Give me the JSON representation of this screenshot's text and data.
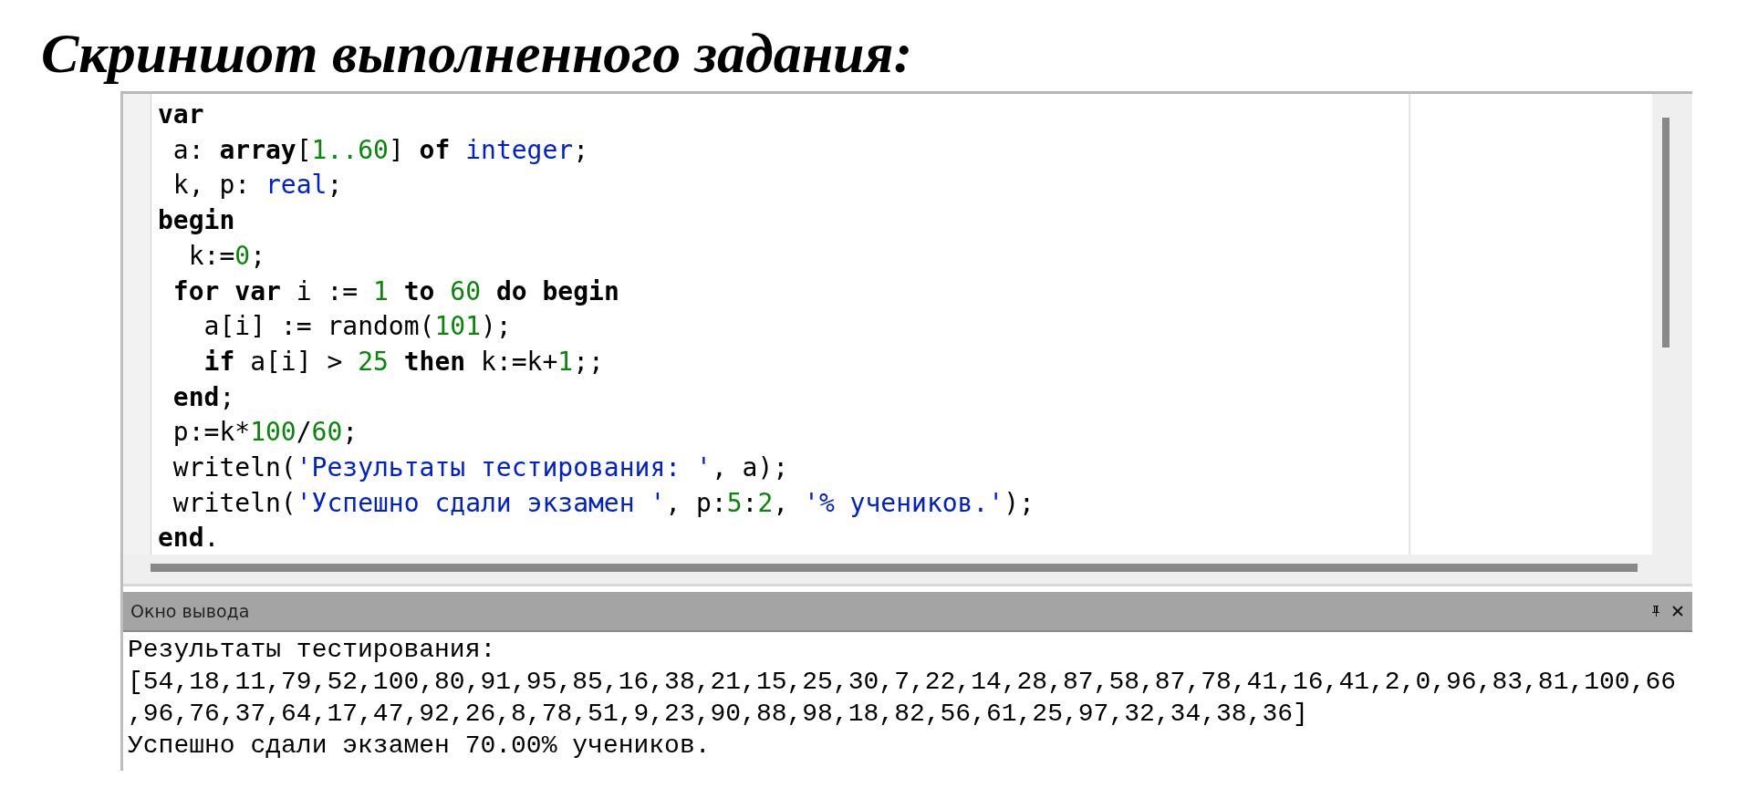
{
  "heading": "Скриншот выполненного задания:",
  "editor": {
    "lines": [
      [
        {
          "text": "var",
          "kind": "keyword"
        }
      ],
      [
        {
          "text": " a: ",
          "kind": "plain"
        },
        {
          "text": "array",
          "kind": "keyword"
        },
        {
          "text": "[",
          "kind": "plain"
        },
        {
          "text": "1..60",
          "kind": "number"
        },
        {
          "text": "] ",
          "kind": "plain"
        },
        {
          "text": "of ",
          "kind": "keyword"
        },
        {
          "text": "integer",
          "kind": "type"
        },
        {
          "text": ";",
          "kind": "plain"
        }
      ],
      [
        {
          "text": " k, p: ",
          "kind": "plain"
        },
        {
          "text": "real",
          "kind": "type"
        },
        {
          "text": ";",
          "kind": "plain"
        }
      ],
      [
        {
          "text": "begin",
          "kind": "keyword"
        }
      ],
      [
        {
          "text": "  k:=",
          "kind": "plain"
        },
        {
          "text": "0",
          "kind": "number"
        },
        {
          "text": ";",
          "kind": "plain"
        }
      ],
      [
        {
          "text": " for var",
          "kind": "keyword"
        },
        {
          "text": " i := ",
          "kind": "plain"
        },
        {
          "text": "1",
          "kind": "number"
        },
        {
          "text": " to ",
          "kind": "keyword"
        },
        {
          "text": "60",
          "kind": "number"
        },
        {
          "text": " do begin",
          "kind": "keyword"
        }
      ],
      [
        {
          "text": "   a[i] := random(",
          "kind": "plain"
        },
        {
          "text": "101",
          "kind": "number"
        },
        {
          "text": ");",
          "kind": "plain"
        }
      ],
      [
        {
          "text": "   if",
          "kind": "keyword"
        },
        {
          "text": " a[i] > ",
          "kind": "plain"
        },
        {
          "text": "25",
          "kind": "number"
        },
        {
          "text": " then",
          "kind": "keyword"
        },
        {
          "text": " k:=k+",
          "kind": "plain"
        },
        {
          "text": "1",
          "kind": "number"
        },
        {
          "text": ";;",
          "kind": "plain"
        }
      ],
      [
        {
          "text": " end",
          "kind": "keyword"
        },
        {
          "text": ";",
          "kind": "plain"
        }
      ],
      [
        {
          "text": " p:=k*",
          "kind": "plain"
        },
        {
          "text": "100",
          "kind": "number"
        },
        {
          "text": "/",
          "kind": "plain"
        },
        {
          "text": "60",
          "kind": "number"
        },
        {
          "text": ";",
          "kind": "plain"
        }
      ],
      [
        {
          "text": " writeln(",
          "kind": "plain"
        },
        {
          "text": "'Результаты тестирования: '",
          "kind": "string"
        },
        {
          "text": ", a);",
          "kind": "plain"
        }
      ],
      [
        {
          "text": " writeln(",
          "kind": "plain"
        },
        {
          "text": "'Успешно сдали экзамен '",
          "kind": "string"
        },
        {
          "text": ", p:",
          "kind": "plain"
        },
        {
          "text": "5",
          "kind": "number"
        },
        {
          "text": ":",
          "kind": "plain"
        },
        {
          "text": "2",
          "kind": "number"
        },
        {
          "text": ", ",
          "kind": "plain"
        },
        {
          "text": "'% учеников.'",
          "kind": "string"
        },
        {
          "text": ");",
          "kind": "plain"
        }
      ],
      [
        {
          "text": "end",
          "kind": "keyword"
        },
        {
          "text": ".",
          "kind": "plain"
        }
      ]
    ]
  },
  "output": {
    "title": "Окно вывода",
    "lines": [
      "Результаты тестирования:",
      "[54,18,11,79,52,100,80,91,95,85,16,38,21,15,25,30,7,22,14,28,87,58,87,78,41,16,41,2,0,96,83,81,100,66",
      ",96,76,37,64,17,47,92,26,8,78,51,9,23,90,88,98,18,82,56,61,25,97,32,34,38,36]",
      "Успешно сдали экзамен 70.00% учеников."
    ]
  }
}
